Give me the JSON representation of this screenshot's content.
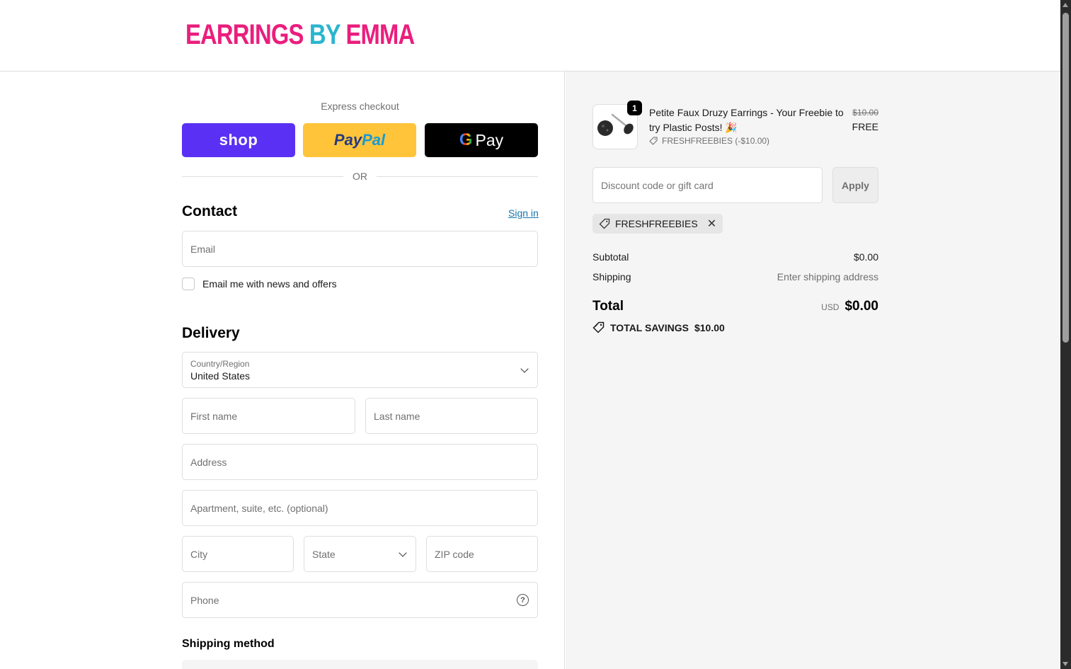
{
  "brand": {
    "logo_part1": "EARRINGS ",
    "logo_part2": "BY ",
    "logo_part3": "EMMA"
  },
  "express": {
    "title": "Express checkout",
    "shop_label": "shop",
    "paypal_label_1": "Pay",
    "paypal_label_2": "Pal",
    "gpay_g": "G",
    "gpay_label": "Pay",
    "or_label": "OR"
  },
  "contact": {
    "heading": "Contact",
    "sign_in": "Sign in",
    "email_placeholder": "Email",
    "newsletter_label": "Email me with news and offers"
  },
  "delivery": {
    "heading": "Delivery",
    "country_label": "Country/Region",
    "country_value": "United States",
    "first_name_placeholder": "First name",
    "last_name_placeholder": "Last name",
    "address_placeholder": "Address",
    "apartment_placeholder": "Apartment, suite, etc. (optional)",
    "city_placeholder": "City",
    "state_label": "State",
    "zip_placeholder": "ZIP code",
    "phone_placeholder": "Phone",
    "help_glyph": "?"
  },
  "shipping_method": {
    "heading": "Shipping method"
  },
  "order": {
    "item": {
      "quantity": "1",
      "name": "Petite Faux Druzy Earrings - Your Freebie to try Plastic Posts! 🎉",
      "discount": "FRESHFREEBIES (-$10.00)",
      "price_old": "$10.00",
      "price_new": "FREE"
    },
    "discount_placeholder": "Discount code or gift card",
    "apply_label": "Apply",
    "applied_code": "FRESHFREEBIES",
    "remove_glyph": "✕",
    "subtotal_label": "Subtotal",
    "subtotal_value": "$0.00",
    "shipping_label": "Shipping",
    "shipping_value": "Enter shipping address",
    "total_label": "Total",
    "total_currency": "USD",
    "total_value": "$0.00",
    "savings_label": "TOTAL SAVINGS",
    "savings_value": "$10.00"
  },
  "colors": {
    "logo_pink": "#ea1e7d",
    "logo_teal": "#2bb5cf",
    "shop_purple": "#5a31f4",
    "paypal_yellow": "#ffc439",
    "link_blue": "#1773b0"
  },
  "icons": {
    "tag": "tag-icon",
    "close": "close-icon",
    "chevron": "chevron-down-icon",
    "help": "help-circle-icon",
    "savings": "savings-tag-icon"
  }
}
